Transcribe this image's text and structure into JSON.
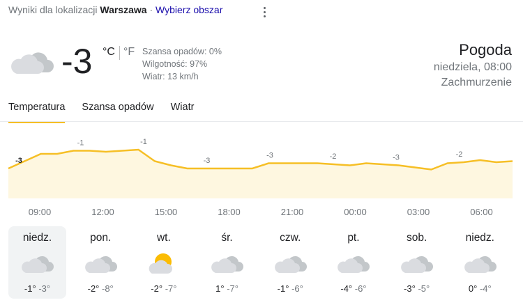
{
  "location": {
    "prefix": "Wyniki dla lokalizacji",
    "city": "Warszawa",
    "separator": "·",
    "change_link": "Wybierz obszar"
  },
  "current": {
    "icon": "cloudy-icon",
    "temperature": "-3",
    "unit_c": "°C",
    "unit_f": "°F",
    "precip": "Szansa opadów: 0%",
    "humidity": "Wilgotność: 97%",
    "wind": "Wiatr: 13 km/h"
  },
  "header": {
    "title": "Pogoda",
    "datetime": "niedziela, 08:00",
    "condition": "Zachmurzenie"
  },
  "tabs": [
    {
      "label": "Temperatura",
      "active": true
    },
    {
      "label": "Szansa opadów",
      "active": false
    },
    {
      "label": "Wiatr",
      "active": false
    }
  ],
  "colors": {
    "accent": "#f6bf26",
    "fill": "#fef7e0",
    "text_secondary": "#70757a",
    "link": "#1a0dab"
  },
  "chart_data": {
    "type": "area",
    "title": "",
    "labels": [
      "-3",
      "-1",
      "-1",
      "-3",
      "-3",
      "-2",
      "-3",
      "-2"
    ],
    "values": [
      -3,
      -2.3,
      -1.6,
      -1.6,
      -1.3,
      -1.3,
      -1.4,
      -1.3,
      -1.2,
      -2.3,
      -2.7,
      -3,
      -3,
      -3,
      -3,
      -3,
      -2.5,
      -2.5,
      -2.5,
      -2.5,
      -2.6,
      -2.7,
      -2.5,
      -2.6,
      -2.7,
      -2.9,
      -3.1,
      -2.5,
      -2.4,
      -2.2,
      -2.4,
      -2.3
    ],
    "times": [
      "09:00",
      "12:00",
      "15:00",
      "18:00",
      "21:00",
      "00:00",
      "03:00",
      "06:00"
    ]
  },
  "days": [
    {
      "name": "niedz.",
      "icon": "cloudy-icon",
      "high": "-1°",
      "low": "-3°",
      "selected": true
    },
    {
      "name": "pon.",
      "icon": "cloudy-icon",
      "high": "-2°",
      "low": "-8°",
      "selected": false
    },
    {
      "name": "wt.",
      "icon": "partly-cloudy-icon",
      "high": "-2°",
      "low": "-7°",
      "selected": false
    },
    {
      "name": "śr.",
      "icon": "cloudy-icon",
      "high": "1°",
      "low": "-7°",
      "selected": false
    },
    {
      "name": "czw.",
      "icon": "cloudy-icon",
      "high": "-1°",
      "low": "-6°",
      "selected": false
    },
    {
      "name": "pt.",
      "icon": "cloudy-icon",
      "high": "-4°",
      "low": "-6°",
      "selected": false
    },
    {
      "name": "sob.",
      "icon": "cloudy-icon",
      "high": "-3°",
      "low": "-5°",
      "selected": false
    },
    {
      "name": "niedz.",
      "icon": "cloudy-icon",
      "high": "0°",
      "low": "-4°",
      "selected": false
    }
  ]
}
